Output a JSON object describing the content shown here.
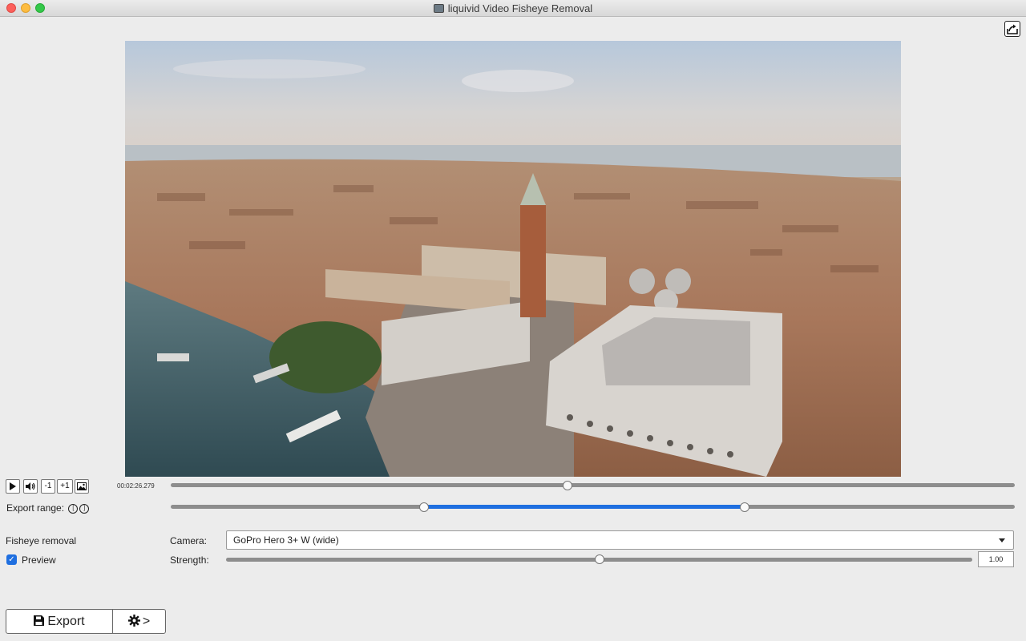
{
  "window": {
    "title": "liquivid Video Fisheye Removal"
  },
  "toolbar": {
    "share_icon": "share-export-icon"
  },
  "player": {
    "play_icon": "play-icon",
    "volume_icon": "volume-icon",
    "minus_one_label": "-1",
    "plus_one_label": "+1",
    "snapshot_icon": "image-icon",
    "timecode": "00:02:26.279",
    "position_fraction": 0.47
  },
  "export_range": {
    "label": "Export range:",
    "start_marker": "[",
    "end_marker": "]",
    "start_fraction": 0.3,
    "end_fraction": 0.68
  },
  "fisheye": {
    "section_label": "Fisheye removal",
    "preview_label": "Preview",
    "preview_checked": true,
    "camera_label": "Camera:",
    "camera_value": "GoPro Hero 3+ W (wide)",
    "strength_label": "Strength:",
    "strength_value": "1.00",
    "strength_fraction": 0.5
  },
  "actions": {
    "export_label": "Export",
    "settings_label": ">"
  },
  "colors": {
    "accent": "#1f6fe0",
    "background": "#ececec"
  }
}
